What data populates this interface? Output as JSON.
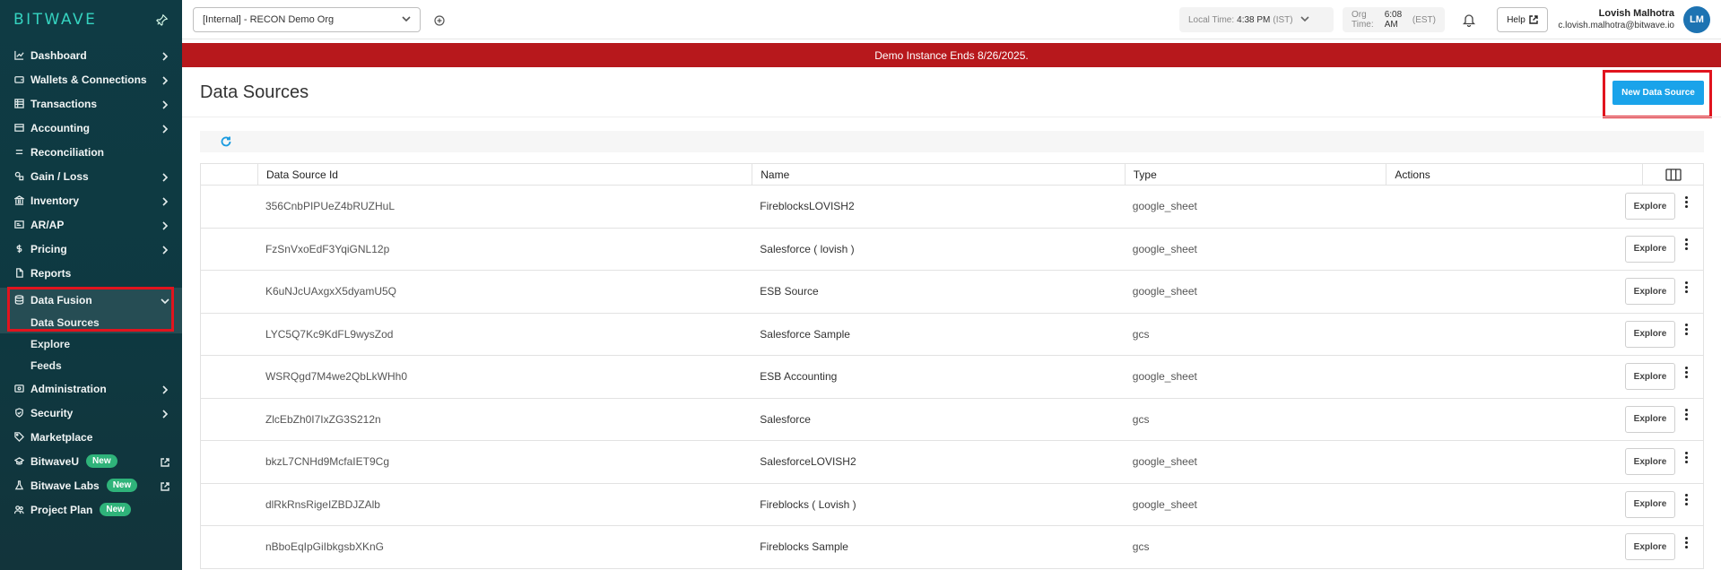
{
  "sidebar": {
    "logo": "BITWAVE",
    "items": [
      {
        "label": "Dashboard",
        "icon": "chart-icon",
        "chevron": true
      },
      {
        "label": "Wallets & Connections",
        "icon": "wallet-icon",
        "chevron": true
      },
      {
        "label": "Transactions",
        "icon": "list-icon",
        "chevron": true
      },
      {
        "label": "Accounting",
        "icon": "accounting-icon",
        "chevron": true
      },
      {
        "label": "Reconciliation",
        "icon": "equals-icon",
        "chevron": false
      },
      {
        "label": "Gain / Loss",
        "icon": "gain-loss-icon",
        "chevron": true
      },
      {
        "label": "Inventory",
        "icon": "bank-icon",
        "chevron": true
      },
      {
        "label": "AR/AP",
        "icon": "invoice-icon",
        "chevron": true
      },
      {
        "label": "Pricing",
        "icon": "dollar-icon",
        "chevron": true
      },
      {
        "label": "Reports",
        "icon": "document-icon",
        "chevron": false
      }
    ],
    "data_fusion": {
      "label": "Data Fusion",
      "subitems": [
        "Data Sources",
        "Explore",
        "Feeds"
      ]
    },
    "bottom_items": [
      {
        "label": "Administration",
        "icon": "admin-icon",
        "chevron": true
      },
      {
        "label": "Security",
        "icon": "shield-icon",
        "chevron": true
      },
      {
        "label": "Marketplace",
        "icon": "tag-icon",
        "chevron": false
      }
    ],
    "external_items": [
      {
        "label": "BitwaveU",
        "badge": "New",
        "external": true
      },
      {
        "label": "Bitwave Labs",
        "badge": "New",
        "external": true
      },
      {
        "label": "Project Plan",
        "badge": "New",
        "external": false
      }
    ]
  },
  "topbar": {
    "org": "[Internal] - RECON Demo Org",
    "local_time_label": "Local Time:",
    "local_time_value": "4:38 PM",
    "local_time_zone": "(IST)",
    "org_time_label": "Org Time:",
    "org_time_value": "6:08 AM",
    "org_time_zone": "(EST)",
    "help": "Help",
    "user_name": "Lovish Malhotra",
    "user_email": "c.lovish.malhotra@bitwave.io",
    "avatar_initials": "LM"
  },
  "banner": "Demo Instance Ends 8/26/2025.",
  "page": {
    "title": "Data Sources",
    "new_button": "New Data Source"
  },
  "table": {
    "headers": [
      "Data Source Id",
      "Name",
      "Type",
      "Actions"
    ],
    "explore_label": "Explore",
    "rows": [
      {
        "id": "356CnbPIPUeZ4bRUZHuL",
        "name": "FireblocksLOVISH2",
        "type": "google_sheet"
      },
      {
        "id": "FzSnVxoEdF3YqiGNL12p",
        "name": "Salesforce ( lovish )",
        "type": "google_sheet"
      },
      {
        "id": "K6uNJcUAxgxX5dyamU5Q",
        "name": "ESB Source",
        "type": "google_sheet"
      },
      {
        "id": "LYC5Q7Kc9KdFL9wysZod",
        "name": "Salesforce Sample",
        "type": "gcs"
      },
      {
        "id": "WSRQgd7M4we2QbLkWHh0",
        "name": "ESB Accounting",
        "type": "google_sheet"
      },
      {
        "id": "ZlcEbZh0I7IxZG3S212n",
        "name": "Salesforce",
        "type": "gcs"
      },
      {
        "id": "bkzL7CNHd9McfaIET9Cg",
        "name": "SalesforceLOVISH2",
        "type": "google_sheet"
      },
      {
        "id": "dlRkRnsRigeIZBDJZAlb",
        "name": "Fireblocks ( Lovish )",
        "type": "google_sheet"
      },
      {
        "id": "nBboEqIpGiIbkgsbXKnG",
        "name": "Fireblocks Sample",
        "type": "gcs"
      }
    ]
  },
  "colors": {
    "sidebar_bg": "#0f3b44",
    "accent": "#35d3c0",
    "banner": "#b7181c",
    "primary_button": "#1aa3ea",
    "highlight": "#e1141e"
  }
}
